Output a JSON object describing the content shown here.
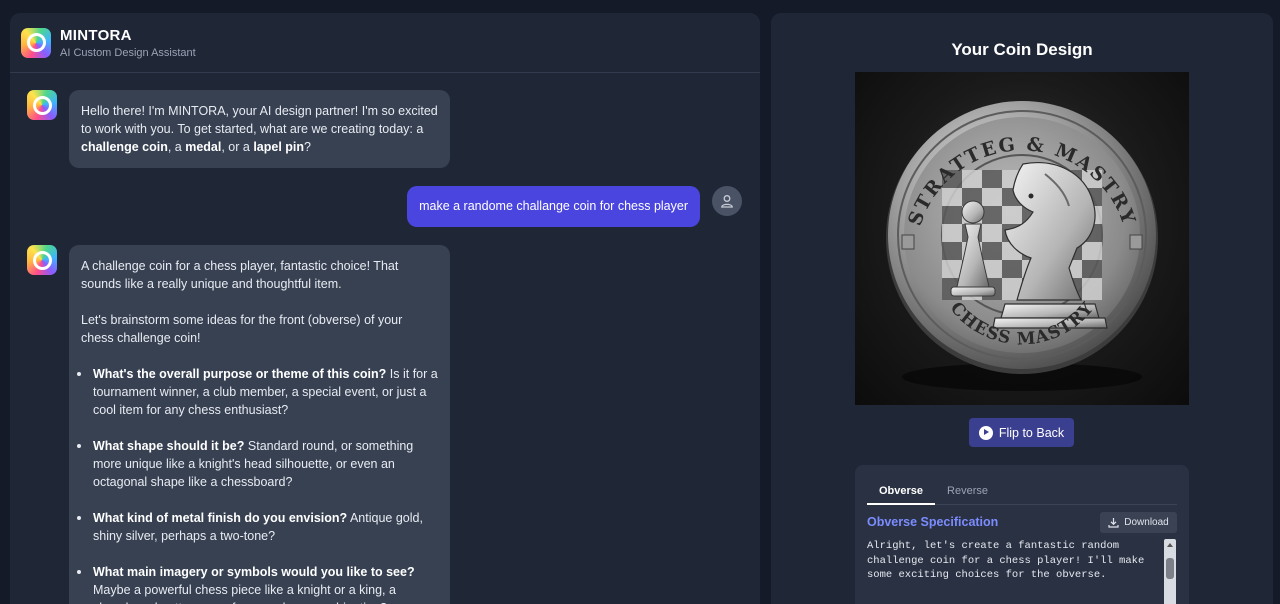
{
  "app": {
    "name": "MINTORA",
    "subtitle": "AI Custom Design Assistant"
  },
  "chat": {
    "welcome": {
      "intro": "Hello there! I'm MINTORA, your AI design partner! I'm so excited to work with you. To get started, what are we creating today: a ",
      "opt1": "challenge coin",
      "sep1": ", a ",
      "opt2": "medal",
      "sep2": ", or a ",
      "opt3": "lapel pin",
      "end": "?"
    },
    "user_message": "make a randome challange coin for chess player",
    "reply": {
      "p1": "A challenge coin for a chess player, fantastic choice! That sounds like a really unique and thoughtful item.",
      "p2": "Let's brainstorm some ideas for the front (obverse) of your chess challenge coin!",
      "questions": [
        {
          "q": "What's the overall purpose or theme of this coin?",
          "text": " Is it for a tournament winner, a club member, a special event, or just a cool item for any chess enthusiast?"
        },
        {
          "q": "What shape should it be?",
          "text": " Standard round, or something more unique like a knight's head silhouette, or even an octagonal shape like a chessboard?"
        },
        {
          "q": "What kind of metal finish do you envision?",
          "text": " Antique gold, shiny silver, perhaps a two-tone?"
        },
        {
          "q": "What main imagery or symbols would you like to see?",
          "text": " Maybe a powerful chess piece like a knight or a king, a chessboard pattern, or a famous chess combination?"
        }
      ]
    }
  },
  "design": {
    "title": "Your Coin Design",
    "coin_text_top": "STRATTEG & MASTRY",
    "coin_text_bottom": "CHESS MASTRY",
    "flip_label": "Flip to Back",
    "tabs": [
      "Obverse",
      "Reverse"
    ],
    "active_tab": "Obverse",
    "spec_title": "Obverse Specification",
    "download_label": "Download",
    "spec_text": "Alright, let's create a fantastic random challenge coin for a chess player! I'll make some exciting choices for the obverse.",
    "colors": {
      "accent": "#4b45e0",
      "button": "#3b3f8f",
      "spec_title": "#7b8cff"
    }
  }
}
